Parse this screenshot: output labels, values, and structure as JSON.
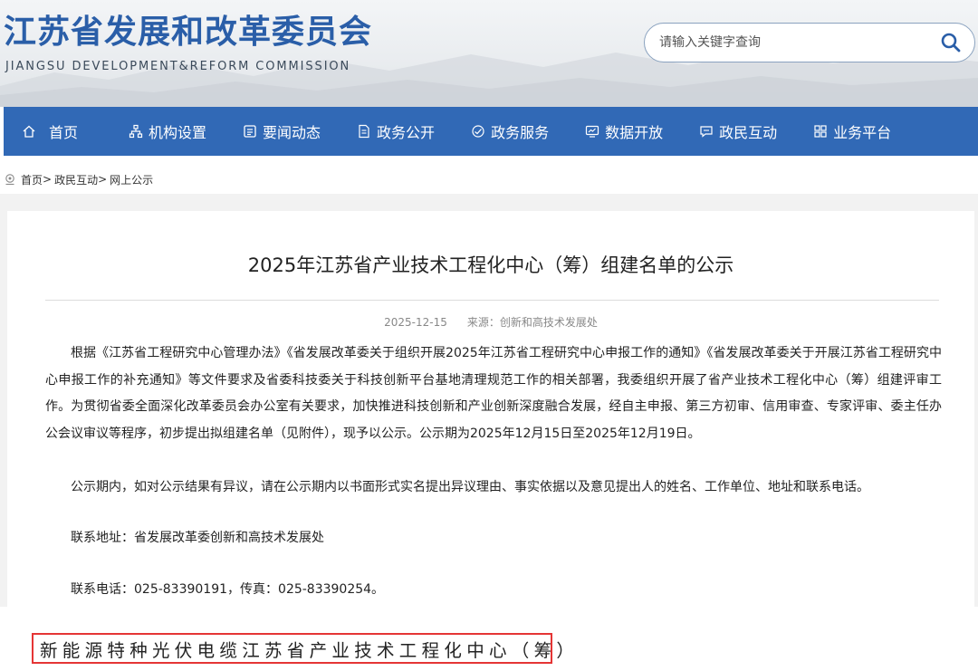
{
  "header": {
    "title": "江苏省发展和改革委员会",
    "subtitle": "JIANGSU DEVELOPMENT&REFORM COMMISSION",
    "search": {
      "placeholder": "请输入关键字查询",
      "icon": "search-icon"
    }
  },
  "nav": {
    "items": [
      {
        "label": "首页",
        "icon": "home-icon"
      },
      {
        "label": "机构设置",
        "icon": "org-chart-icon"
      },
      {
        "label": "要闻动态",
        "icon": "news-icon"
      },
      {
        "label": "政务公开",
        "icon": "document-icon"
      },
      {
        "label": "政务服务",
        "icon": "service-icon"
      },
      {
        "label": "数据开放",
        "icon": "data-icon"
      },
      {
        "label": "政民互动",
        "icon": "chat-icon"
      },
      {
        "label": "业务平台",
        "icon": "grid-icon"
      }
    ],
    "color": "#3169b6"
  },
  "breadcrumb": {
    "icon": "location-icon",
    "items": [
      "首页",
      "政民互动",
      "网上公示"
    ],
    "separator": ">"
  },
  "article": {
    "title": "2025年江苏省产业技术工程化中心（筹）组建名单的公示",
    "date": "2025-12-15",
    "source": "来源：创新和高技术发展处",
    "paragraphs": [
      "根据《江苏省工程研究中心管理办法》《省发展改革委关于组织开展2025年江苏省工程研究中心申报工作的通知》《省发展改革委关于开展江苏省工程研究中心申报工作的补充通知》等文件要求及省委科技委关于科技创新平台基地清理规范工作的相关部署，我委组织开展了省产业技术工程化中心（筹）组建评审工作。为贯彻省委全面深化改革委员会办公室有关要求，加快推进科技创新和产业创新深度融合发展，经自主申报、第三方初审、信用审查、专家评审、委主任办公会议审议等程序，初步提出拟组建名单（见附件），现予以公示。公示期为2025年12月15日至2025年12月19日。",
      "公示期内，如对公示结果有异议，请在公示期内以书面形式实名提出异议理由、事实依据以及意见提出人的姓名、工作单位、地址和联系电话。",
      "联系地址：省发展改革委创新和高技术发展处",
      "联系电话：025-83390191，传真：025-83390254。"
    ]
  },
  "highlight": {
    "text": "新能源特种光伏电缆江苏省产业技术工程化中心（筹）",
    "border_color": "#e53535"
  }
}
